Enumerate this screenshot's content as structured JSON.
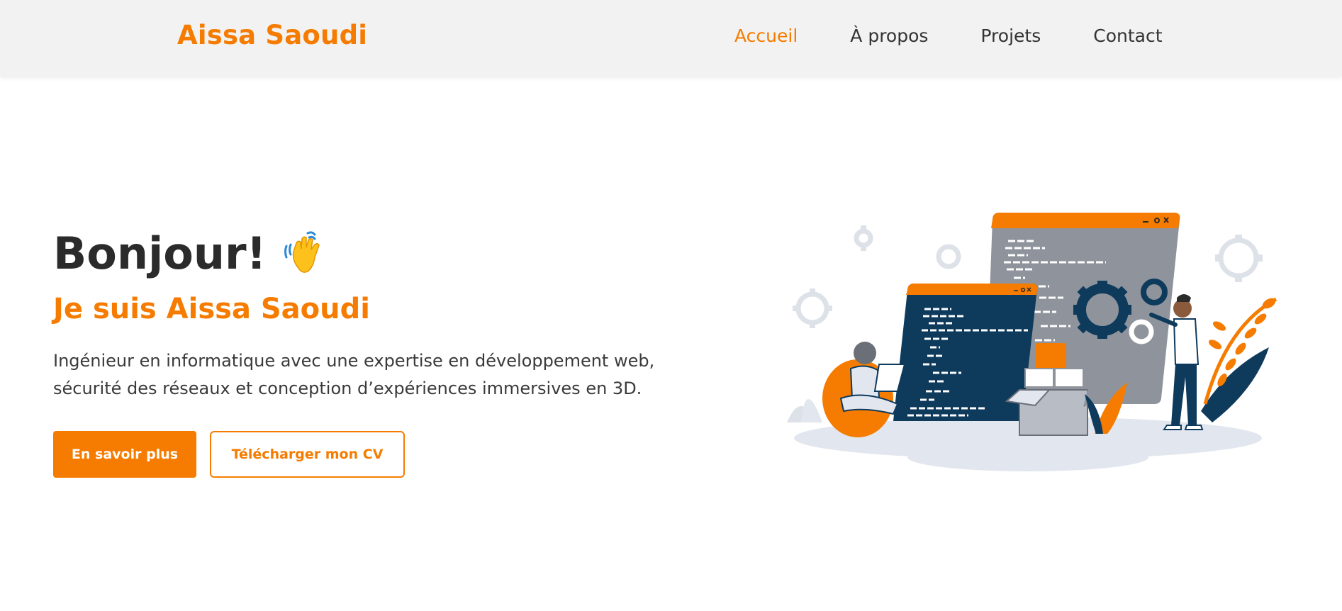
{
  "header": {
    "brand": "Aissa Saoudi",
    "nav": [
      {
        "label": "Accueil",
        "active": true
      },
      {
        "label": "À propos",
        "active": false
      },
      {
        "label": "Projets",
        "active": false
      },
      {
        "label": "Contact",
        "active": false
      }
    ]
  },
  "hero": {
    "greeting": "Bonjour!",
    "greeting_icon": "waving-hand-icon",
    "subtitle": "Je suis Aissa Saoudi",
    "description_line1": "Ingénieur en informatique avec une expertise en développement web,",
    "description_line2": "sécurité des réseaux et conception d’expériences immersives en 3D.",
    "primary_button": "En savoir plus",
    "secondary_button": "Télécharger mon CV",
    "illustration": "developers-coding-illustration"
  },
  "colors": {
    "accent": "#f57c00",
    "header_bg": "#f2f2f2",
    "text": "#2b2b2b",
    "navy": "#0e3a5c",
    "gray_window": "#8f949c"
  }
}
